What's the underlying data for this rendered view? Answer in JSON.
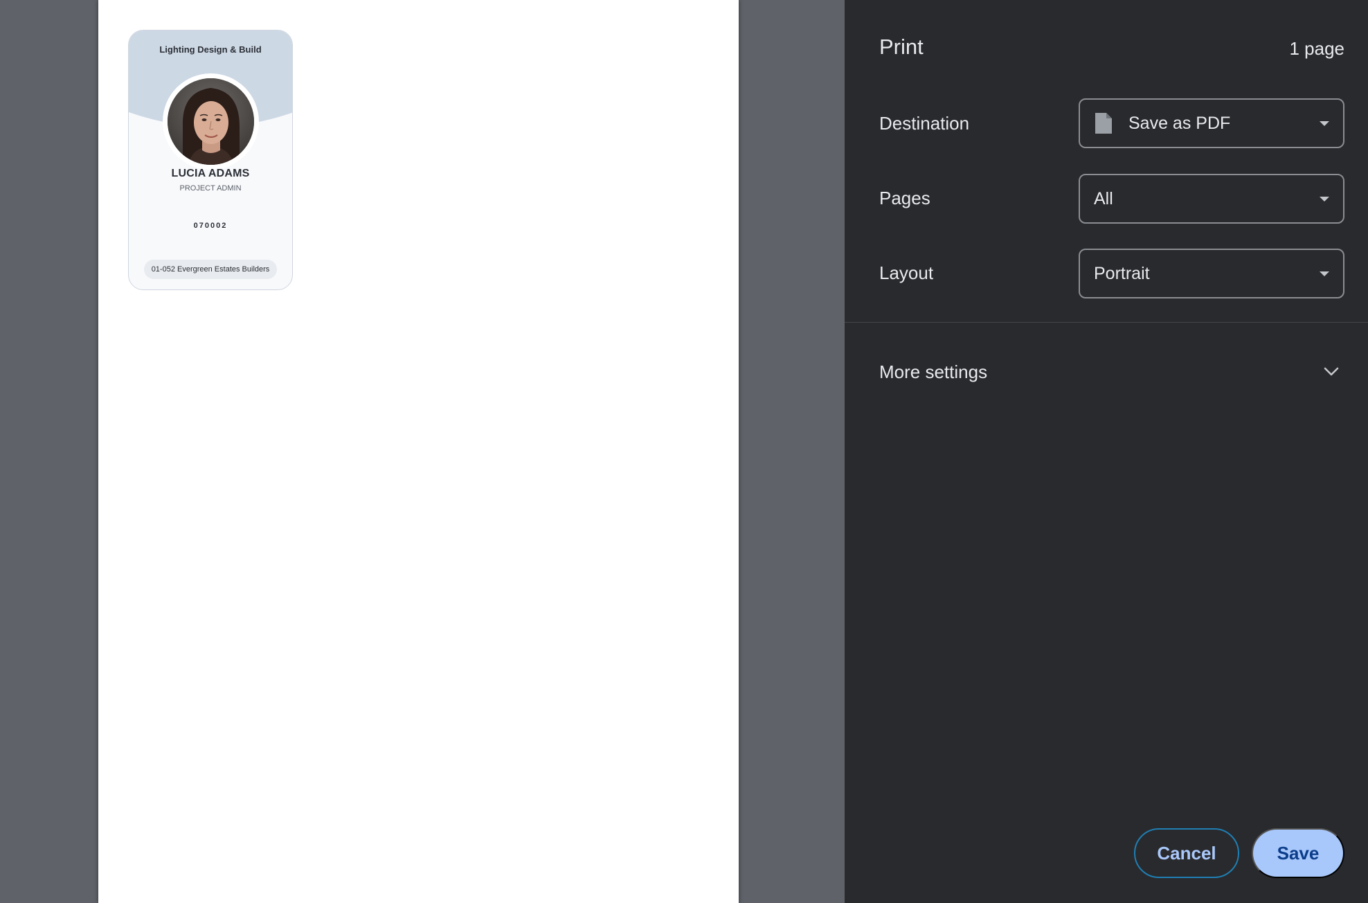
{
  "preview": {
    "badge": {
      "company": "Lighting Design & Build",
      "name": "LUCIA ADAMS",
      "role": "PROJECT ADMIN",
      "id_number": "070002",
      "project": "01-052 Evergreen Estates Builders",
      "photo_icon": "person-photo"
    }
  },
  "print_panel": {
    "title": "Print",
    "page_count": "1 page",
    "destination": {
      "label": "Destination",
      "value": "Save as PDF",
      "icon": "file-icon"
    },
    "pages": {
      "label": "Pages",
      "value": "All"
    },
    "layout": {
      "label": "Layout",
      "value": "Portrait"
    },
    "more_settings": {
      "label": "More settings",
      "icon": "chevron-down-icon"
    },
    "buttons": {
      "cancel": "Cancel",
      "save": "Save"
    }
  },
  "colors": {
    "sidebar_bg": "#292a2d",
    "preview_bg": "#5f6269",
    "save_button": "#a8c7fa",
    "cancel_border": "#1f7fb4",
    "badge_accent": "#cdd8e5"
  }
}
